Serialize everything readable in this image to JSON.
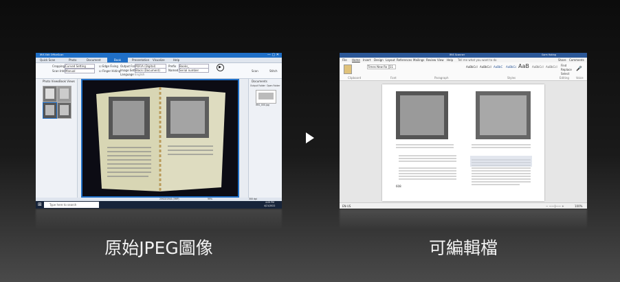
{
  "left_app": {
    "title": "IRIS Edit OfficeScan",
    "tabs": [
      "Quick Scan",
      "Photo",
      "Document",
      "Book",
      "Presentation",
      "Visualize",
      "Help"
    ],
    "active_tab": "Book",
    "ribbon": {
      "cropping_label": "Cropping",
      "cropping_value": "Curved Setting",
      "scan_interval_label": "Scan Interval",
      "scan_interval_value": "Manual",
      "edge_fixing": "Edge Fixing",
      "finger_hiding": "Finger Hiding",
      "output_format_label": "Output Format",
      "output_format_value": "PDF/A (Digital)",
      "image_settings_label": "Image Settings",
      "image_settings_value": "Black (Document)",
      "language_label": "Language",
      "language_value": "English",
      "prefix_label": "Prefix",
      "prefix_value": "Books_",
      "named_by_label": "Named By",
      "named_by_value": "Serial number",
      "demo_video": "Demo Video",
      "scan": "Scan",
      "stitch": "Stitch"
    },
    "left_tabs": [
      "Photo Views",
      "Book Views"
    ],
    "right_panel": {
      "header": "Documents",
      "buttons": [
        "Output Folder",
        "Open Folder"
      ],
      "file": "IRIS_000.jpg"
    },
    "status_bar": {
      "resolution": "2592X1944 (5MP)",
      "zoom": "99%",
      "dpi": "300 dpi"
    },
    "taskbar": {
      "search_placeholder": "Type here to search",
      "time": "4:09 PM",
      "date": "4/21/2022"
    }
  },
  "right_app": {
    "title": "IRIS Scanner",
    "user": "Gorm Hoking",
    "ribbon_tabs": [
      "File",
      "Home",
      "Insert",
      "Design",
      "Layout",
      "References",
      "Mailings",
      "Review",
      "View",
      "Help"
    ],
    "active_tab": "Home",
    "tell_me": "Tell me what you want to do",
    "share": "Share",
    "comments": "Comments",
    "font_name": "Times New Ro",
    "font_size": "11",
    "styles": [
      "AaBbCcI",
      "AaBbCcI",
      "AaBbC",
      "AaBbCc",
      "AaB",
      "AaBbCcI",
      "AaBbCcI"
    ],
    "style_names": [
      "Normal",
      "No Spac...",
      "Heading 1",
      "Heading 2",
      "Title",
      "Subtitle",
      "Subtle Em..."
    ],
    "groups": [
      "Clipboard",
      "Font",
      "Paragraph",
      "Styles",
      "Editing",
      "Voice"
    ],
    "editing": [
      "Find",
      "Replace",
      "Select"
    ],
    "page_number": "608",
    "status_left": "EN-US",
    "zoom": "100%"
  },
  "captions": {
    "left": "原始JPEG圖像",
    "right": "可編輯檔"
  }
}
